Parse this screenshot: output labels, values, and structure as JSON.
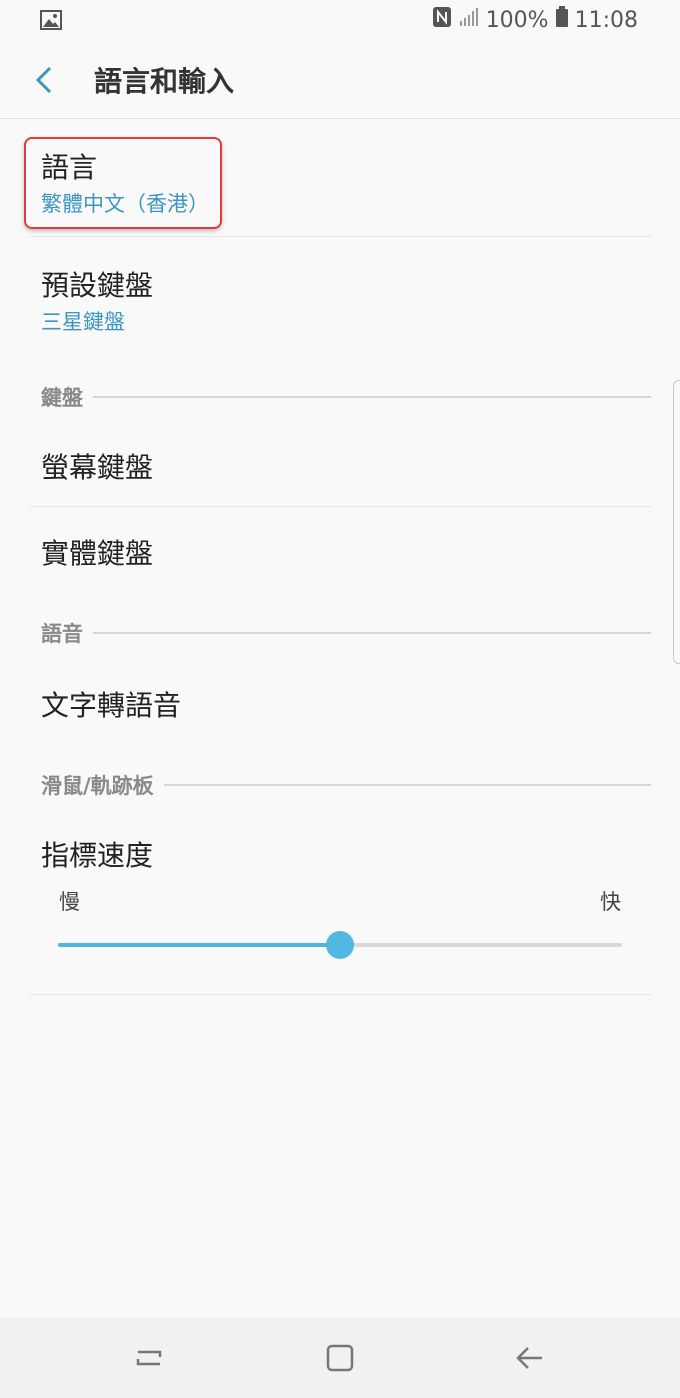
{
  "status_bar": {
    "battery_text": "100%",
    "time": "11:08",
    "icons": [
      "gallery-icon",
      "nfc-icon",
      "signal-icon",
      "battery-icon"
    ]
  },
  "app_bar": {
    "title": "語言和輸入",
    "back_icon": "chevron-left-icon"
  },
  "items": {
    "language": {
      "title": "語言",
      "value": "繁體中文（香港）"
    },
    "default_keyboard": {
      "title": "預設鍵盤",
      "value": "三星鍵盤"
    },
    "screen_keyboard": {
      "title": "螢幕鍵盤"
    },
    "physical_keyboard": {
      "title": "實體鍵盤"
    },
    "tts": {
      "title": "文字轉語音"
    },
    "pointer_speed": {
      "title": "指標速度",
      "min_label": "慢",
      "max_label": "快",
      "level": 0.5
    }
  },
  "sections": {
    "keyboard": "鍵盤",
    "speech": "語音",
    "mouse": "滑鼠/軌跡板"
  },
  "nav_bar": {
    "icons": [
      "recent-apps-icon",
      "home-icon",
      "back-icon"
    ]
  },
  "colors": {
    "accent": "#3b97c2",
    "slider_accent": "#4cb6dd",
    "highlight_border": "#e53a3a",
    "background": "#f9f9f9"
  }
}
